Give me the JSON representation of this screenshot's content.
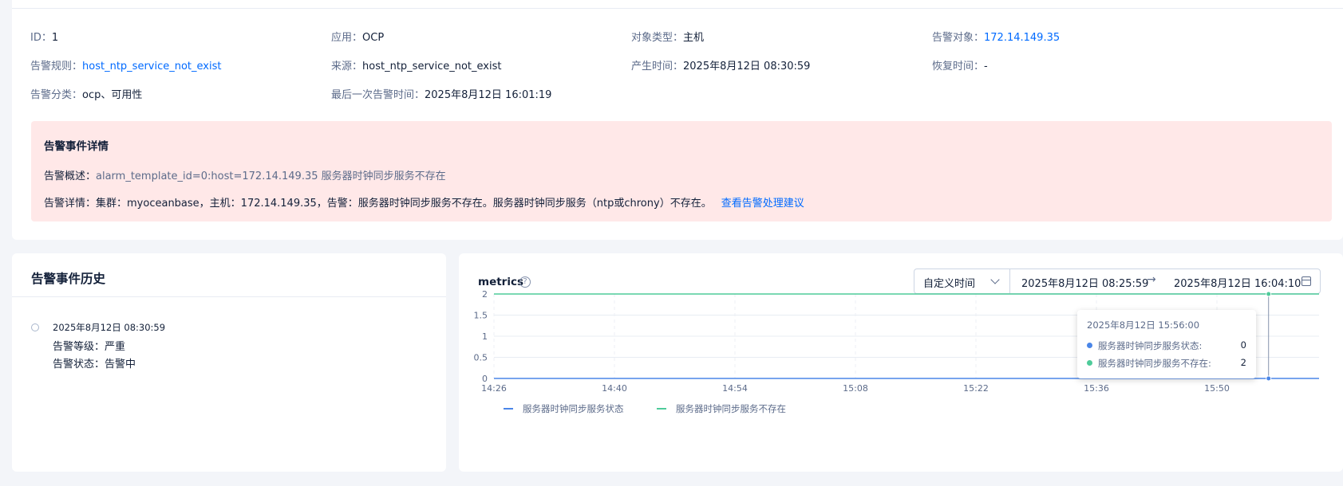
{
  "info": {
    "id_label": "ID：",
    "id_value": "1",
    "app_label": "应用：",
    "app_value": "OCP",
    "obj_type_label": "对象类型：",
    "obj_type_value": "主机",
    "target_label": "告警对象：",
    "target_value": "172.14.149.35",
    "rule_label": "告警规则：",
    "rule_value": "host_ntp_service_not_exist",
    "source_label": "来源：",
    "source_value": "host_ntp_service_not_exist",
    "created_label": "产生时间：",
    "created_value": "2025年8月12日 08:30:59",
    "recovered_label": "恢复时间：",
    "recovered_value": "-",
    "category_label": "告警分类：",
    "category_value": "ocp、可用性",
    "last_label": "最后一次告警时间：",
    "last_value": "2025年8月12日 16:01:19"
  },
  "detail": {
    "title": "告警事件详情",
    "summary_label": "告警概述：",
    "summary_value": "alarm_template_id=0:host=172.14.149.35 服务器时钟同步服务不存在",
    "detail_label": "告警详情：",
    "detail_value": "集群：myoceanbase，主机：172.14.149.35，告警：服务器时钟同步服务不存在。服务器时钟同步服务（ntp或chrony）不存在。",
    "advice_link": "查看告警处理建议"
  },
  "history": {
    "title": "告警事件历史",
    "items": [
      {
        "time": "2025年8月12日 08:30:59",
        "level": "告警等级：严重",
        "status": "告警状态：告警中"
      }
    ]
  },
  "metrics": {
    "title": "metrics",
    "help_icon": "question-circle-icon",
    "range_mode": "自定义时间",
    "range_start": "2025年8月12日 08:25:59",
    "range_arrow": "→",
    "range_end": "2025年8月12日 16:04:10",
    "tooltip": {
      "time": "2025年8月12日 15:56:00",
      "rows": [
        {
          "name": "服务器时钟同步服务状态:",
          "value": "0",
          "color": "#4a86e8"
        },
        {
          "name": "服务器时钟同步服务不存在:",
          "value": "2",
          "color": "#4ecb9a"
        }
      ]
    }
  },
  "chart_data": {
    "type": "line",
    "x": [
      "14:26",
      "14:40",
      "14:54",
      "15:08",
      "15:22",
      "15:36",
      "15:50",
      "15:56"
    ],
    "x_ticks": [
      "14:26",
      "14:40",
      "14:54",
      "15:08",
      "15:22",
      "15:36",
      "15:50"
    ],
    "y_ticks": [
      "0",
      "0.5",
      "1",
      "1.5",
      "2"
    ],
    "ylim": [
      0,
      2
    ],
    "series": [
      {
        "name": "服务器时钟同步服务状态",
        "values": [
          0,
          0,
          0,
          0,
          0,
          0,
          0,
          0
        ],
        "color": "#4a86e8"
      },
      {
        "name": "服务器时钟同步服务不存在",
        "values": [
          2,
          2,
          2,
          2,
          2,
          2,
          2,
          2
        ],
        "color": "#4ecb9a"
      }
    ],
    "highlight_x": "15:56",
    "legend_position": "bottom-left",
    "grid": true
  }
}
